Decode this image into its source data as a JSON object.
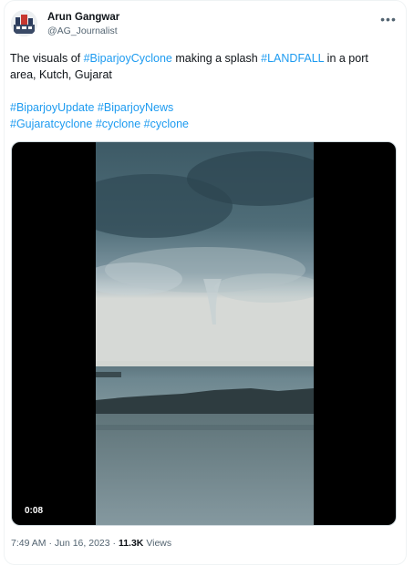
{
  "author": {
    "name": "Arun Gangwar",
    "handle": "@AG_Journalist"
  },
  "more_icon": "more-horizontal-icon",
  "tweet": {
    "line1_parts": [
      {
        "text": "The visuals of ",
        "tag": false
      },
      {
        "text": "#BiparjoyCyclone",
        "tag": true
      },
      {
        "text": " making a splash ",
        "tag": false
      },
      {
        "text": "#LANDFALL",
        "tag": true
      },
      {
        "text": " in a port area, Kutch, Gujarat",
        "tag": false
      }
    ],
    "hashtags_line1": [
      "#BiparjoyUpdate",
      "#BiparjoyNews"
    ],
    "hashtags_line2": [
      "#Gujaratcyclone",
      "#cyclone",
      "#cyclone"
    ]
  },
  "media": {
    "duration": "0:08"
  },
  "meta": {
    "time": "7:49 AM",
    "separator": "·",
    "date": "Jun 16, 2023",
    "views_count": "11.3K",
    "views_label": "Views"
  },
  "colors": {
    "hashtag": "#1d9bf0",
    "text": "#0f1419",
    "secondary": "#536471"
  }
}
